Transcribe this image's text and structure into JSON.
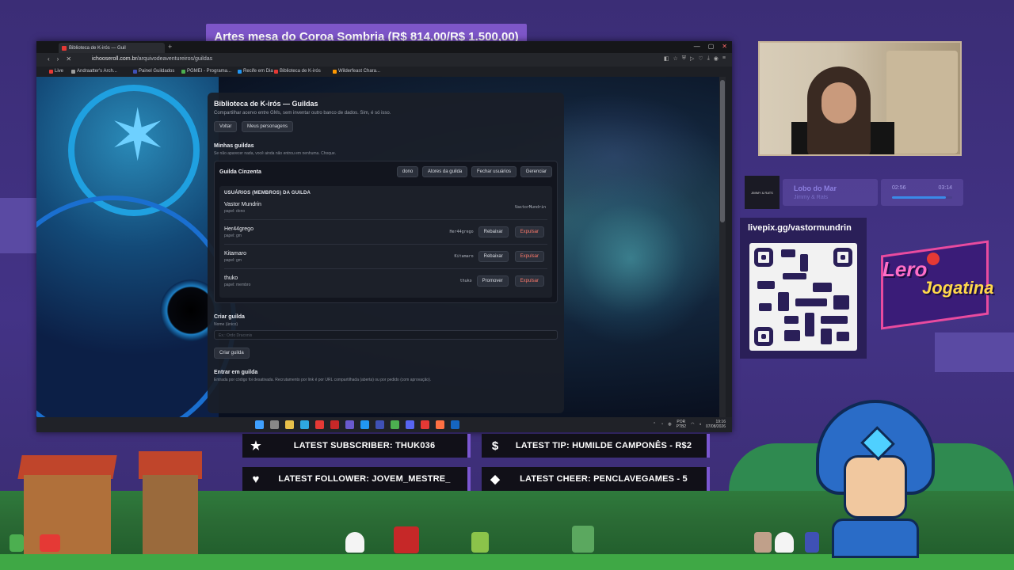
{
  "stream": {
    "title": "Artes mesa do Coroa Sombria (R$ 814,00/R$ 1.500,00)"
  },
  "browser": {
    "tab_title": "Biblioteca de K-irós — Guil",
    "url_host": "ichooseroll.com.br",
    "url_path": "/arquivodeaventureiros/guildas",
    "bookmarks": [
      {
        "label": "Live",
        "color": "#e53935"
      },
      {
        "label": "Andraatter's Arch...",
        "color": "#9e9e9e"
      },
      {
        "label": "Painel Guildados",
        "color": "#3f51b5"
      },
      {
        "label": "PGMEI - Programa...",
        "color": "#4caf50"
      },
      {
        "label": "Recife em Dia",
        "color": "#2196f3"
      },
      {
        "label": "Biblioteca de K-irós",
        "color": "#e53935"
      },
      {
        "label": "Wilderfeast Chara...",
        "color": "#ff9800"
      }
    ]
  },
  "page": {
    "title": "Biblioteca de K-irós — Guildas",
    "subtitle": "Compartilhar acervo entre GMs, sem inventar outro banco de dados. Sim, é só isso.",
    "back_label": "Voltar",
    "characters_label": "Meus personagens",
    "my_guilds": {
      "title": "Minhas guildas",
      "hint": "Se não aparecer nada, você ainda não entrou em nenhuma. Choque."
    },
    "guild": {
      "name": "Guilda Cinzenta",
      "role_badge": "dono",
      "actors_label": "Atores da guilda",
      "close_users_label": "Fechar usuários",
      "manage_label": "Gerenciar",
      "members_title": "USUÁRIOS (MEMBROS) DA GUILDA",
      "members": [
        {
          "name": "Vastor Mundrin",
          "role": "papel: dono",
          "handle": "VastorMundrin",
          "demote": "",
          "kick": ""
        },
        {
          "name": "Her44grego",
          "role": "papel: gm",
          "handle": "Her44grego",
          "demote": "Rebaixar",
          "kick": "Expulsar"
        },
        {
          "name": "Kitamaro",
          "role": "papel: gm",
          "handle": "Kitamaro",
          "demote": "Rebaixar",
          "kick": "Expulsar"
        },
        {
          "name": "thuko",
          "role": "papel: membro",
          "handle": "thuko",
          "demote": "Promover",
          "kick": "Expulsar"
        }
      ]
    },
    "create": {
      "title": "Criar guilda",
      "name_label": "Nome (único)",
      "name_placeholder": "Ex.: Ordo Draconis",
      "button": "Criar guilda"
    },
    "join": {
      "title": "Entrar em guilda",
      "hint": "Entrada por código foi desativada. Recrutamento por link é por URL compartilhada (aberta) ou por pedido (com aprovação)."
    }
  },
  "taskbar": {
    "lang": "POR",
    "layout": "PTB2",
    "time": "19:16",
    "date": "07/08/2026",
    "icon_colors": [
      "#3fa0ff",
      "#888888",
      "#e8c04a",
      "#2ea7e0",
      "#e53935",
      "#c62828",
      "#6a5acd",
      "#2196f3",
      "#3f51b5",
      "#4caf50",
      "#5865f2",
      "#e53935",
      "#ff7043",
      "#1565c0"
    ]
  },
  "music": {
    "cover_text": "JIMMY & RATS",
    "title": "Lobo do Mar",
    "artist": "Jimmy & Rats",
    "current": "02:56",
    "total": "03:14",
    "progress": 0.9
  },
  "livepix": {
    "label": "livepix.gg/vastormundrin"
  },
  "logo": {
    "line1": "Lero",
    "line2": "Jogatina"
  },
  "events": {
    "subscriber": "LATEST SUBSCRIBER: THUK036",
    "tip": "LATEST TIP: HUMILDE CAMPONÊS - R$2",
    "follower": "LATEST FOLLOWER: JOVEM_MESTRE_",
    "cheer": "LATEST CHEER: PENCLAVEGAMES - 5",
    "icons": {
      "subscriber": "star-icon",
      "tip": "dollar-icon",
      "follower": "heart-icon",
      "cheer": "diamond-icon"
    }
  }
}
